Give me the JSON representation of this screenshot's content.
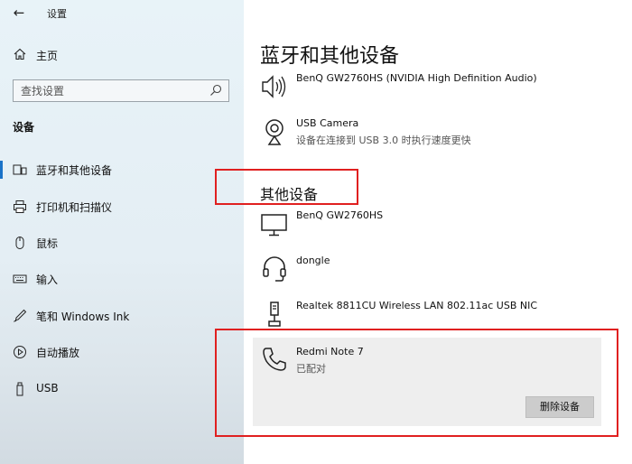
{
  "window": {
    "back_glyph": "←",
    "title": "设置"
  },
  "sidebar": {
    "home_label": "主页",
    "search_placeholder": "查找设置",
    "section_title": "设备",
    "items": [
      {
        "label": "蓝牙和其他设备",
        "icon": "bluetooth-devices-icon",
        "active": true
      },
      {
        "label": "打印机和扫描仪",
        "icon": "printer-icon"
      },
      {
        "label": "鼠标",
        "icon": "mouse-icon"
      },
      {
        "label": "输入",
        "icon": "keyboard-icon"
      },
      {
        "label": "笔和 Windows Ink",
        "icon": "pen-icon"
      },
      {
        "label": "自动播放",
        "icon": "autoplay-icon"
      },
      {
        "label": "USB",
        "icon": "usb-icon"
      }
    ]
  },
  "main": {
    "title": "蓝牙和其他设备",
    "audio_devices": [
      {
        "name": "BenQ GW2760HS (NVIDIA High Definition Audio)",
        "status": "",
        "icon": "speaker-icon"
      },
      {
        "name": "USB Camera",
        "status": "设备在连接到 USB 3.0 时执行速度更快",
        "icon": "webcam-icon"
      }
    ],
    "other_title": "其他设备",
    "other_devices": [
      {
        "name": "BenQ GW2760HS",
        "status": "",
        "icon": "monitor-icon"
      },
      {
        "name": "dongle",
        "status": "",
        "icon": "headset-icon"
      },
      {
        "name": "Realtek 8811CU Wireless LAN 802.11ac USB NIC",
        "status": "",
        "icon": "network-adapter-icon"
      }
    ],
    "selected_device": {
      "name": "Redmi Note 7",
      "status": "已配对",
      "icon": "phone-icon",
      "remove_label": "删除设备"
    }
  },
  "colors": {
    "accent": "#1a73c8",
    "annotation": "#e02020",
    "sidebar_bg": "#e6f1f7",
    "card_bg": "#eeeeee"
  }
}
